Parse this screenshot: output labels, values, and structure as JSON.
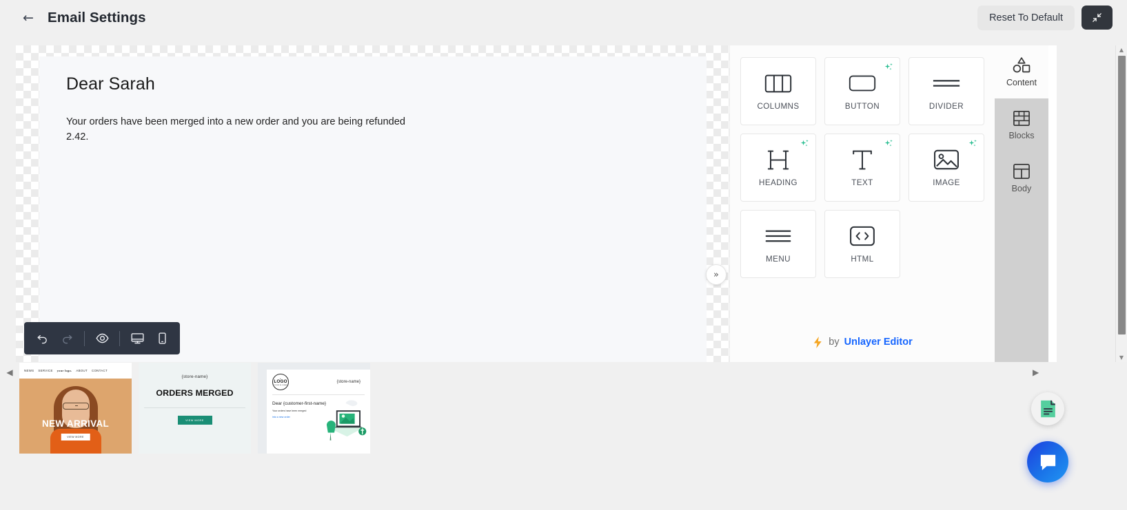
{
  "header": {
    "back_icon": "back-arrow-icon",
    "title": "Email Settings",
    "reset_label": "Reset To Default",
    "collapse_icon": "collapse-arrows-icon"
  },
  "canvas": {
    "greeting": "Dear Sarah",
    "body_text": "Your orders have been merged into a new order and you are being refunded 2.42.",
    "toolbar": [
      {
        "name": "undo-button",
        "icon": "undo-icon",
        "enabled": true
      },
      {
        "name": "redo-button",
        "icon": "redo-icon",
        "enabled": false
      },
      {
        "name": "preview-button",
        "icon": "eye-icon",
        "enabled": true
      },
      {
        "name": "desktop-button",
        "icon": "desktop-icon",
        "enabled": true
      },
      {
        "name": "mobile-button",
        "icon": "mobile-icon",
        "enabled": true
      }
    ],
    "expand_icon": "chevron-double-right-icon"
  },
  "tool_panel": {
    "tiles": [
      {
        "label": "COLUMNS",
        "icon": "columns-icon",
        "ai": false
      },
      {
        "label": "BUTTON",
        "icon": "button-icon",
        "ai": true
      },
      {
        "label": "DIVIDER",
        "icon": "divider-icon",
        "ai": false
      },
      {
        "label": "HEADING",
        "icon": "heading-icon",
        "ai": true
      },
      {
        "label": "TEXT",
        "icon": "text-icon",
        "ai": true
      },
      {
        "label": "IMAGE",
        "icon": "image-icon",
        "ai": true
      },
      {
        "label": "MENU",
        "icon": "menu-icon",
        "ai": false
      },
      {
        "label": "HTML",
        "icon": "code-icon",
        "ai": false
      }
    ],
    "footer": {
      "bolt_icon": "lightning-bolt-icon",
      "by": "by",
      "brand": "Unlayer Editor"
    }
  },
  "tabs": [
    {
      "label": "Content",
      "icon": "shapes-icon",
      "active": true
    },
    {
      "label": "Blocks",
      "icon": "bricks-icon",
      "active": false
    },
    {
      "label": "Body",
      "icon": "layout-icon",
      "active": false
    }
  ],
  "scrollbar": {
    "up_icon": "triangle-up-icon",
    "down_icon": "triangle-down-icon"
  },
  "thumbnails": {
    "prev_icon": "triangle-left-icon",
    "next_icon": "triangle-right-icon",
    "items": [
      {
        "name": "fashion-template",
        "logo": "your logo.",
        "nav": [
          "NEWS",
          "SERVICE",
          "ABOUT",
          "CONTACT"
        ],
        "title": "NEW ARRIVAL",
        "cta": "VIEW MORE"
      },
      {
        "name": "orders-merged-template",
        "store": "{store-name}",
        "title": "ORDERS MERGED",
        "cta": "VIEW MORE"
      },
      {
        "name": "order-detail-template",
        "logo_main": "LOGO",
        "logo_sub": "YOUR SLOGAN",
        "store": "{store-name}",
        "greeting": "Dear {customer-first-name}",
        "line1": "Your orders have been merged",
        "line2": "into a new order"
      }
    ]
  },
  "fab": {
    "docs_icon": "document-icon",
    "chat_icon": "chat-bubble-icon"
  },
  "colors": {
    "accent_blue": "#1565ff",
    "ai_green": "#2dbf93",
    "toolbar_dark": "#2f3643",
    "teal_button": "#1a8e75"
  }
}
